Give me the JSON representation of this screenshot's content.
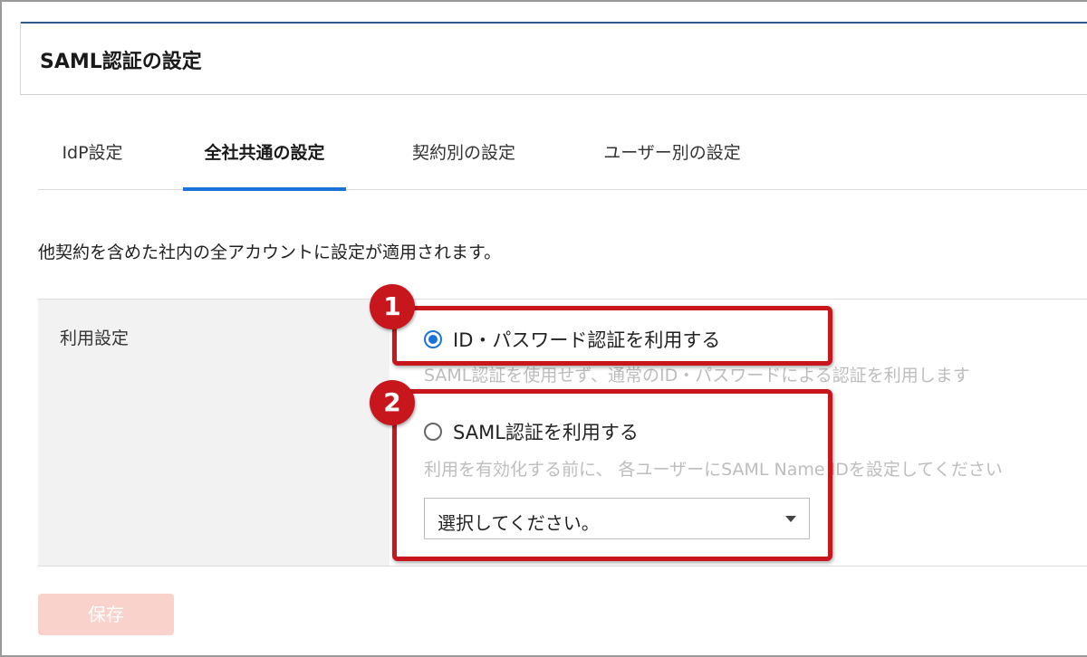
{
  "page": {
    "title": "SAML認証の設定"
  },
  "tabs": [
    {
      "label": "IdP設定",
      "active": false
    },
    {
      "label": "全社共通の設定",
      "active": true
    },
    {
      "label": "契約別の設定",
      "active": false
    },
    {
      "label": "ユーザー別の設定",
      "active": false
    }
  ],
  "description": "他契約を含めた社内の全アカウントに設定が適用されます。",
  "usage_setting": {
    "label": "利用設定",
    "options": [
      {
        "label": "ID・パスワード認証を利用する",
        "hint": "SAML認証を使用せず、通常のID・パスワードによる認証を利用します",
        "checked": true
      },
      {
        "label": "SAML認証を利用する",
        "hint": "利用を有効化する前に、 各ユーザーにSAML Name IDを設定してください",
        "checked": false
      }
    ],
    "select": {
      "value": "選択してください。"
    }
  },
  "annotations": {
    "badge_1": "1",
    "badge_2": "2"
  },
  "actions": {
    "save_label": "保存",
    "save_enabled": false
  },
  "colors": {
    "accent": "#1a73d9",
    "highlight": "#c8161d",
    "save_disabled_bg": "#f9d2cc"
  }
}
